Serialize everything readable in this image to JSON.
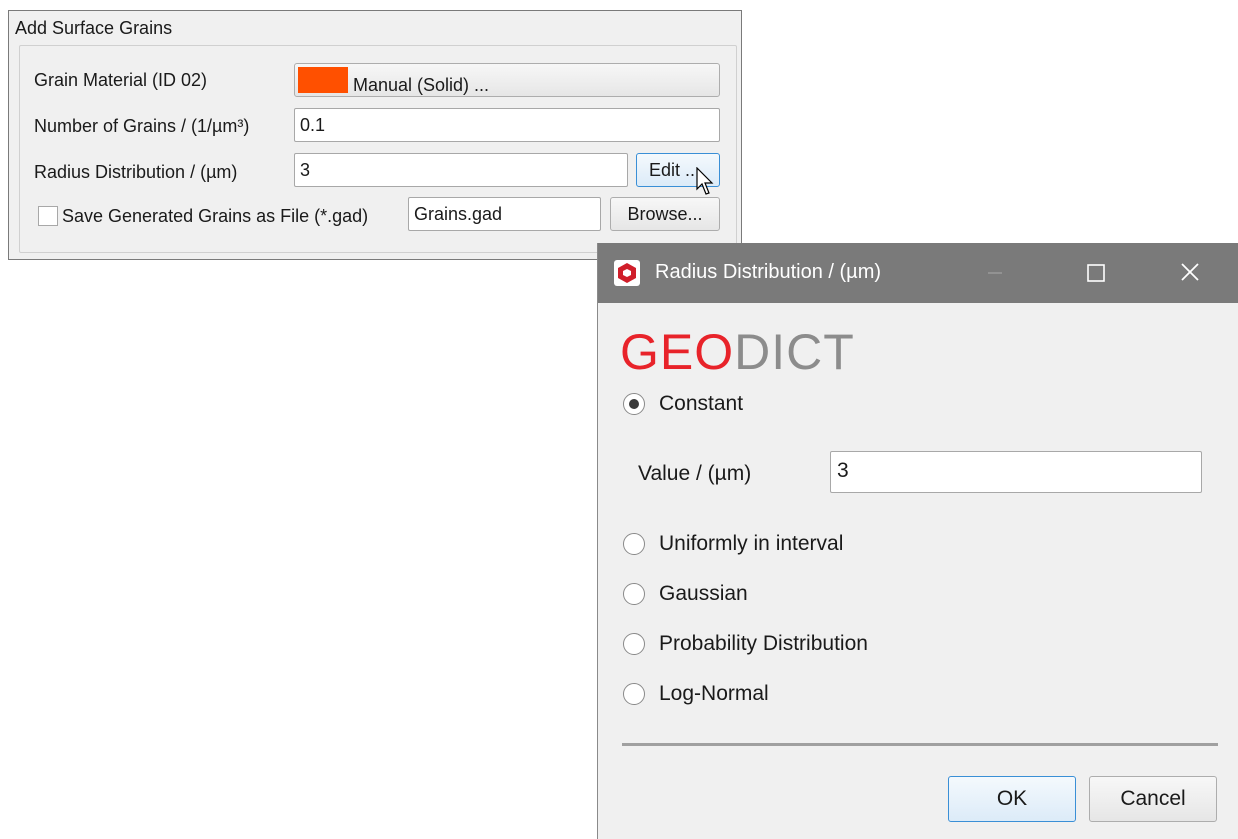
{
  "panel": {
    "title": "Add Surface Grains",
    "material_label": "Grain Material (ID 02)",
    "material_value": "Manual (Solid) ...",
    "material_color": "#ff5000",
    "grains_label": "Number of Grains / (1/µm³)",
    "grains_value": "0.1",
    "radius_label": "Radius Distribution / (µm)",
    "radius_value": "3",
    "edit_label": "Edit ...",
    "save_label": "Save Generated Grains as File (*.gad)",
    "save_checked": false,
    "file_value": "Grains.gad",
    "browse_label": "Browse..."
  },
  "dialog": {
    "title": "Radius Distribution / (µm)",
    "logo_geo": "GEO",
    "logo_dict": "DICT",
    "options": [
      {
        "label": "Constant",
        "selected": true
      },
      {
        "label": "Uniformly in interval",
        "selected": false
      },
      {
        "label": "Gaussian",
        "selected": false
      },
      {
        "label": "Probability Distribution",
        "selected": false
      },
      {
        "label": "Log-Normal",
        "selected": false
      }
    ],
    "value_label": "Value / (µm)",
    "value": "3",
    "ok_label": "OK",
    "cancel_label": "Cancel"
  }
}
